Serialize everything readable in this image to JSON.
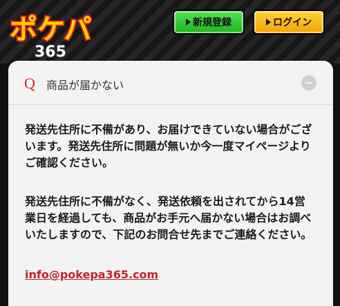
{
  "header": {
    "logo_text": "ポケパ",
    "logo_sub": "365",
    "register_label": "新規登録",
    "login_label": "ログイン"
  },
  "faq": {
    "q_marker": "Q",
    "question": "商品が届かない",
    "paragraphs": [
      "発送先住所に不備があり、お届けできていない場合がございます。発送先住所に問題が無いか今一度マイページよりご確認ください。",
      "発送先住所に不備がなく、発送依頼を出されてから14営業日を経過しても、商品がお手元へ届かない場合はお調べいたしますので、下記のお問合せ先までご連絡ください。"
    ],
    "email": "info@pokepa365.com"
  },
  "colors": {
    "register": "#2fc42f",
    "login": "#f7b500",
    "accent_red": "#c0232f"
  }
}
